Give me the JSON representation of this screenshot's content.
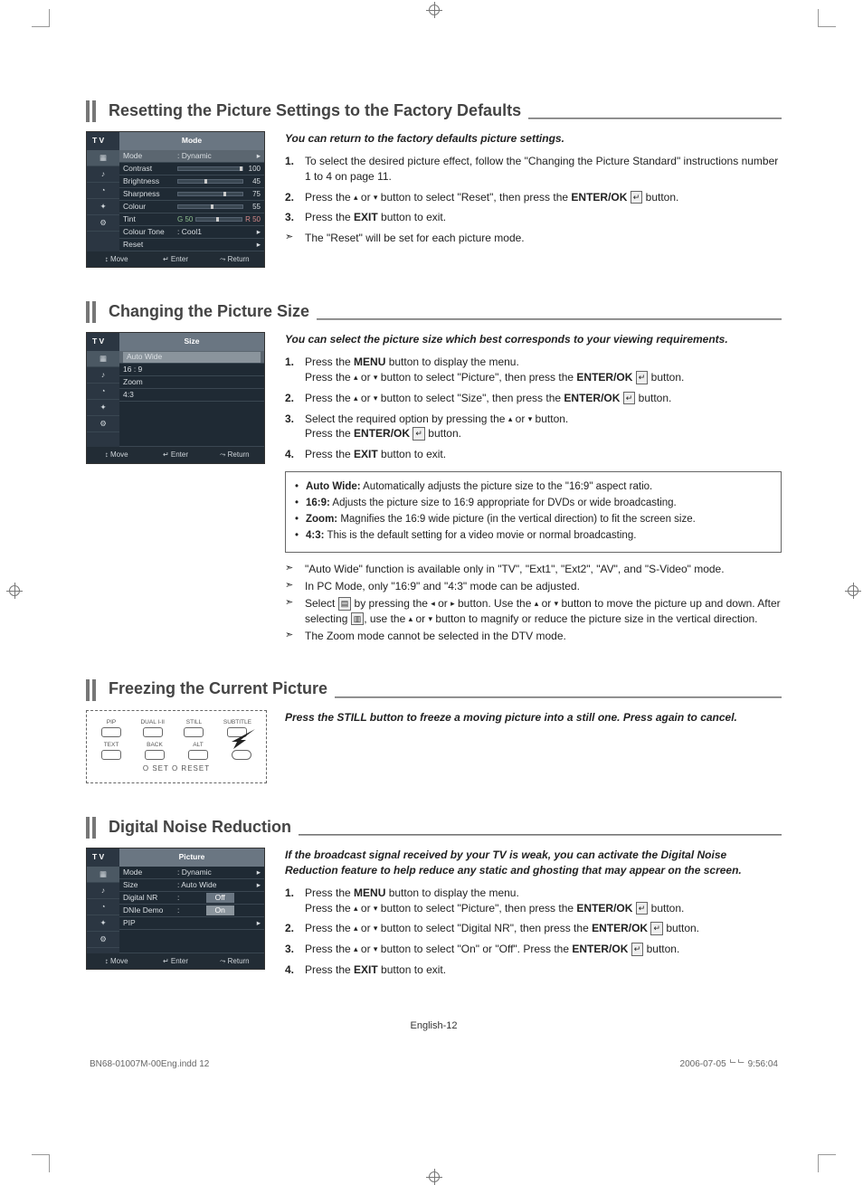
{
  "page": {
    "footer_center": "English-12",
    "doc_file": "BN68-01007M-00Eng.indd   12",
    "doc_timestamp": "2006-07-05   ᄂᄂ 9:56:04"
  },
  "s1": {
    "title": "Resetting the Picture Settings to the Factory Defaults",
    "intro": "You can return to the factory defaults picture settings.",
    "steps": [
      "To select the desired picture effect, follow the \"Changing the Picture Standard\" instructions number 1 to 4 on page 11.",
      "Press the ▴ or ▾ button to select \"Reset\", then press the ENTER/OK ↵ button.",
      "Press the EXIT button to exit."
    ],
    "note": "The \"Reset\" will be set for each picture mode.",
    "osd": {
      "tv": "T V",
      "title": "Mode",
      "rows": [
        {
          "label": "Mode",
          "value": ": Dynamic",
          "type": "chip"
        },
        {
          "label": "Contrast",
          "value": "100",
          "type": "slider"
        },
        {
          "label": "Brightness",
          "value": "45",
          "type": "slider"
        },
        {
          "label": "Sharpness",
          "value": "75",
          "type": "slider"
        },
        {
          "label": "Colour",
          "value": "55",
          "type": "slider"
        },
        {
          "label": "Tint",
          "g": "G 50",
          "r": "R 50",
          "type": "tint"
        },
        {
          "label": "Colour Tone",
          "value": ": Cool1",
          "type": "chip"
        },
        {
          "label": "Reset",
          "value": "",
          "type": "chip"
        }
      ],
      "footer": [
        "↕ Move",
        "↵ Enter",
        "⤳ Return"
      ]
    }
  },
  "s2": {
    "title": "Changing the Picture Size",
    "intro": "You can select the picture size which best corresponds to your viewing requirements.",
    "steps": [
      "Press the MENU button to display the menu. Press the ▴ or ▾ button to select \"Picture\", then press the ENTER/OK ↵ button.",
      "Press the ▴ or ▾ button to select \"Size\", then press the ENTER/OK ↵ button.",
      "Select the required option by pressing the ▴ or ▾ button. Press the ENTER/OK ↵ button.",
      "Press the EXIT button to exit."
    ],
    "bullets": [
      {
        "label": "Auto Wide:",
        "text": " Automatically adjusts the picture size to the \"16:9\" aspect ratio."
      },
      {
        "label": "16:9:",
        "text": " Adjusts the picture size to 16:9 appropriate for DVDs or wide broadcasting."
      },
      {
        "label": "Zoom:",
        "text": " Magnifies the 16:9 wide picture (in the vertical direction) to fit the screen size."
      },
      {
        "label": "4:3:",
        "text": " This is the default setting for a video movie or normal broadcasting."
      }
    ],
    "notes": [
      "\"Auto Wide\" function is available only in \"TV\", \"Ext1\", \"Ext2\", \"AV\", and \"S-Video\" mode.",
      "In PC Mode, only \"16:9\" and \"4:3\" mode can be adjusted.",
      "Select ▤ by pressing the ◂ or ▸ button. Use the ▴ or ▾ button to move the picture up and down. After selecting ▤, use the ▴ or ▾ button to magnify or reduce the picture size in the vertical direction.",
      "The Zoom mode cannot be selected in the DTV mode."
    ],
    "osd": {
      "tv": "T V",
      "title": "Size",
      "rows": [
        {
          "label": "Auto Wide",
          "type": "hl"
        },
        {
          "label": "16 : 9",
          "type": "item"
        },
        {
          "label": "Zoom",
          "type": "item"
        },
        {
          "label": "4:3",
          "type": "item"
        }
      ],
      "footer": [
        "↕ Move",
        "↵ Enter",
        "⤳ Return"
      ]
    }
  },
  "s3": {
    "title": "Freezing the Current Picture",
    "intro": "Press the STILL button to freeze a moving picture into a still one. Press again to cancel.",
    "remote": {
      "row1": [
        "PIP",
        "DUAL I-II",
        "STILL",
        "SUBTITLE"
      ],
      "row2": [
        "TEXT",
        "BACK",
        "ALT"
      ],
      "row3": "O SET     O RESET"
    }
  },
  "s4": {
    "title": "Digital Noise Reduction",
    "intro": "If the broadcast signal received by your TV is weak, you can activate the Digital Noise Reduction feature to help reduce any static and ghosting that may appear on the screen.",
    "steps": [
      "Press the MENU button to display the menu. Press the ▴ or ▾ button to select \"Picture\", then press the ENTER/OK ↵ button.",
      "Press the ▴ or ▾ button to select \"Digital NR\", then press the ENTER/OK ↵ button.",
      "Press the ▴ or ▾ button to select \"On\" or \"Off\". Press the ENTER/OK ↵ button.",
      "Press the EXIT button to exit."
    ],
    "osd": {
      "tv": "T V",
      "title": "Picture",
      "rows": [
        {
          "label": "Mode",
          "value": ": Dynamic",
          "type": "chip"
        },
        {
          "label": "Size",
          "value": ": Auto Wide",
          "type": "chip"
        },
        {
          "label": "Digital NR",
          "value": "Off",
          "type": "field",
          "mid": ":"
        },
        {
          "label": "DNIe Demo",
          "value": "On",
          "type": "field-hl",
          "mid": ":"
        },
        {
          "label": "PIP",
          "value": "",
          "type": "chip"
        }
      ],
      "footer": [
        "↕ Move",
        "↵ Enter",
        "⤳ Return"
      ]
    }
  }
}
